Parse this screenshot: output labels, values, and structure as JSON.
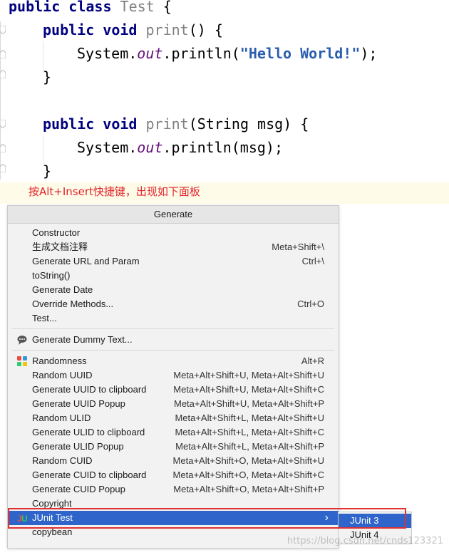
{
  "editor": {
    "lines": [
      {
        "parts": [
          [
            "kw",
            "public class "
          ],
          [
            "dim",
            "Test"
          ],
          [
            "plain",
            " {"
          ]
        ]
      },
      {
        "parts": [
          [
            "kw",
            "public void "
          ],
          [
            "dim",
            "print"
          ],
          [
            "plain",
            "() {"
          ]
        ]
      },
      {
        "parts": [
          [
            "plain",
            "System."
          ],
          [
            "it",
            "out"
          ],
          [
            "plain",
            ".println("
          ],
          [
            "str2",
            "\"Hello World!\""
          ],
          [
            "plain",
            ");"
          ]
        ]
      },
      {
        "parts": [
          [
            "plain",
            "}"
          ]
        ]
      },
      {
        "parts": [
          [
            "kw",
            "public void "
          ],
          [
            "dim",
            "print"
          ],
          [
            "plain",
            "(String msg) {"
          ]
        ]
      },
      {
        "parts": [
          [
            "plain",
            "System."
          ],
          [
            "it",
            "out"
          ],
          [
            "plain",
            ".println(msg);"
          ]
        ]
      },
      {
        "parts": [
          [
            "plain",
            "}"
          ]
        ]
      }
    ]
  },
  "annotation": {
    "text": "按Alt+Insert快捷键，出现如下面板",
    "color": "#e0252b"
  },
  "popup": {
    "title": "Generate",
    "groups": [
      [
        {
          "label": "Constructor",
          "shortcut": ""
        },
        {
          "label": "生成文档注释",
          "shortcut": "Meta+Shift+\\"
        },
        {
          "label": "Generate URL and Param",
          "shortcut": "Ctrl+\\"
        },
        {
          "label": "toString()",
          "shortcut": ""
        },
        {
          "label": "Generate Date",
          "shortcut": ""
        },
        {
          "label": "Override Methods...",
          "shortcut": "Ctrl+O"
        },
        {
          "label": "Test...",
          "shortcut": ""
        }
      ],
      [
        {
          "label": "Generate Dummy Text...",
          "shortcut": "",
          "icon": "speech-bubble-icon"
        }
      ],
      [
        {
          "label": "Randomness",
          "shortcut": "Alt+R",
          "icon": "randomness-icon"
        },
        {
          "label": "Random UUID",
          "shortcut": "Meta+Alt+Shift+U, Meta+Alt+Shift+U"
        },
        {
          "label": "Generate UUID to clipboard",
          "shortcut": "Meta+Alt+Shift+U, Meta+Alt+Shift+C"
        },
        {
          "label": "Generate UUID Popup",
          "shortcut": "Meta+Alt+Shift+U, Meta+Alt+Shift+P"
        },
        {
          "label": "Random ULID",
          "shortcut": "Meta+Alt+Shift+L, Meta+Alt+Shift+U"
        },
        {
          "label": "Generate ULID to clipboard",
          "shortcut": "Meta+Alt+Shift+L, Meta+Alt+Shift+C"
        },
        {
          "label": "Generate ULID Popup",
          "shortcut": "Meta+Alt+Shift+L, Meta+Alt+Shift+P"
        },
        {
          "label": "Random CUID",
          "shortcut": "Meta+Alt+Shift+O, Meta+Alt+Shift+U"
        },
        {
          "label": "Generate CUID to clipboard",
          "shortcut": "Meta+Alt+Shift+O, Meta+Alt+Shift+C"
        },
        {
          "label": "Generate CUID Popup",
          "shortcut": "Meta+Alt+Shift+O, Meta+Alt+Shift+P"
        },
        {
          "label": "Copyright",
          "shortcut": ""
        },
        {
          "label": "JUnit Test",
          "shortcut": "",
          "icon": "junit-icon",
          "selected": true,
          "submenu": true
        },
        {
          "label": "copybean",
          "shortcut": ""
        }
      ]
    ]
  },
  "submenu": {
    "items": [
      {
        "label": "JUnit 3",
        "selected": true
      },
      {
        "label": "JUnit 4",
        "selected": false
      }
    ]
  },
  "watermark": "https://blog.csdn.net/cnds123321",
  "colors": {
    "selection": "#2f65ca",
    "highlight_box": "#e03030"
  }
}
